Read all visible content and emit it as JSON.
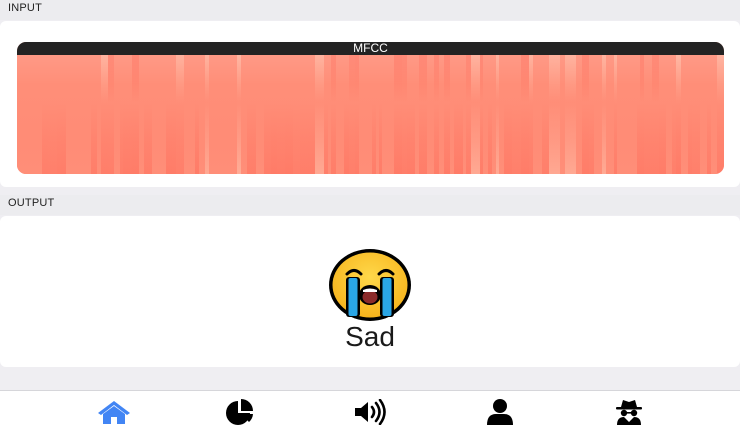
{
  "input_section": {
    "header": "INPUT",
    "mfcc_title": "MFCC"
  },
  "output_section": {
    "header": "OUTPUT",
    "emotion_label": "Sad",
    "emotion_icon": "loudly-crying-face-icon"
  },
  "bottom_nav": {
    "items": [
      {
        "icon": "home-icon",
        "active": true
      },
      {
        "icon": "pie-chart-icon",
        "active": false
      },
      {
        "icon": "volume-icon",
        "active": false
      },
      {
        "icon": "user-icon",
        "active": false
      },
      {
        "icon": "spy-icon",
        "active": false
      }
    ],
    "active_color": "#4285f4",
    "inactive_color": "#000000"
  },
  "colors": {
    "heatmap_base": "#ff8e78",
    "heatmap_light": "#ffb09a",
    "heatmap_dark": "#ff7a66",
    "titlebar": "#232323"
  }
}
